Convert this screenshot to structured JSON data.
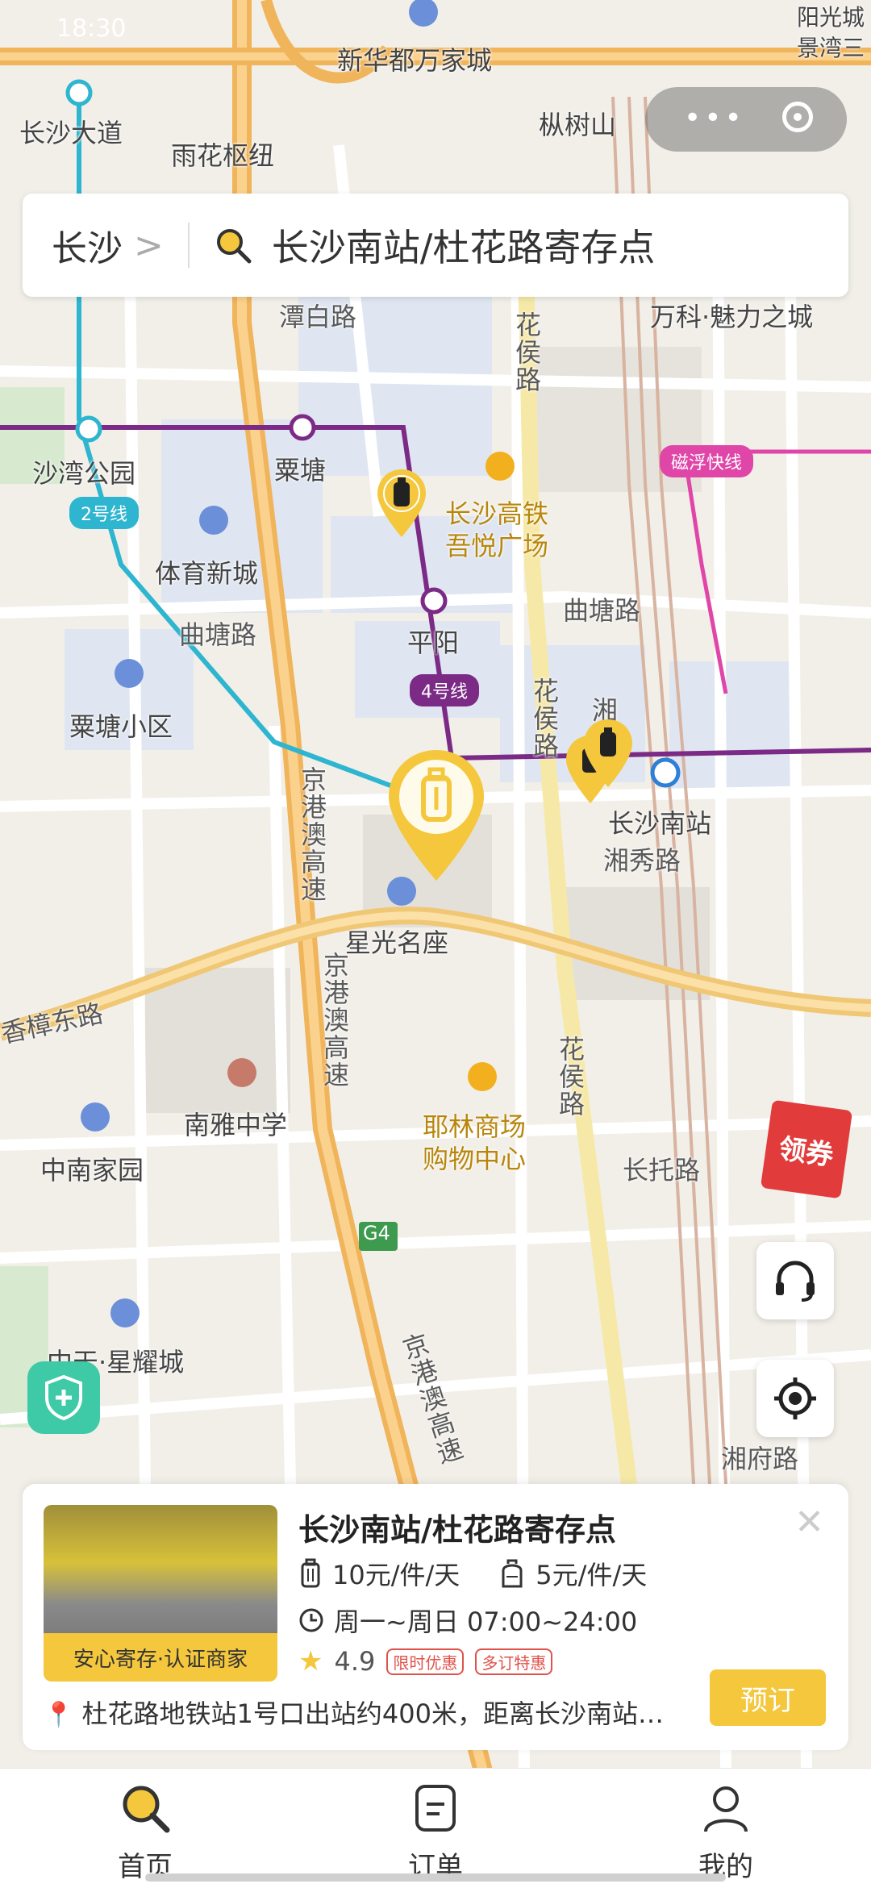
{
  "status_bar": {
    "time": "18:30"
  },
  "capsule": {
    "more_icon": "more-dots-icon",
    "close_icon": "target-icon"
  },
  "search": {
    "city": "长沙",
    "query": "长沙南站/杜花路寄存点"
  },
  "map_labels": {
    "xinhua": "新华都万家城",
    "yanguang": "阳光城",
    "jingwan": "景湾三",
    "changsha_dadao": "长沙大道",
    "yuhua_shuniu": "雨花枢纽",
    "fengshu": "枞树山",
    "tanbai": "潭白路",
    "wanke": "万科·魅力之城",
    "huahou1": "花侯路",
    "shawan_park": "沙湾公园",
    "line2": "2号线",
    "litang_station": "粟塘",
    "cs_gaotie_1": "长沙高铁",
    "cs_gaotie_2": "吾悦广场",
    "maglev": "磁浮快线",
    "tiyu": "体育新城",
    "qutang1": "曲塘路",
    "qutang2": "曲塘路",
    "pingyang": "平阳",
    "line4": "4号线",
    "litang_xiaoqu": "粟塘小区",
    "huahou2": "花侯路",
    "xiang": "湘",
    "cs_south": "长沙南站",
    "xiangxiu": "湘秀路",
    "jgao1": "京港澳高速",
    "xingguang": "星光名座",
    "xiangzhang": "香樟东路",
    "jgao2": "京港澳高速",
    "nanya": "南雅中学",
    "yelin1": "耶林商场",
    "yelin2": "购物中心",
    "huahou3": "花侯路",
    "zhongnan": "中南家园",
    "changtuo": "长托路",
    "g4": "G4",
    "jgao3": "京港澳高速",
    "zhongtian": "中天·星耀城",
    "xiangfu": "湘府路"
  },
  "redpacket": {
    "label": "领券"
  },
  "store_card": {
    "title": "长沙南站/杜花路寄存点",
    "badge": "安心寄存·认证商家",
    "price_large": "10元/件/天",
    "price_small": "5元/件/天",
    "hours": "周一~周日 07:00~24:00",
    "rating": "4.9",
    "tag1": "限时优惠",
    "tag2": "多订特惠",
    "address": "杜花路地铁站1号口出站约400米，距离长沙南站…",
    "book_label": "预订"
  },
  "tabs": [
    {
      "label": "首页",
      "icon": "search-icon"
    },
    {
      "label": "订单",
      "icon": "order-icon"
    },
    {
      "label": "我的",
      "icon": "user-icon"
    }
  ],
  "colors": {
    "accent": "#f4c73d",
    "line4": "#7b2a86",
    "line2": "#2eb5cf",
    "maglev": "#e045a8",
    "highway": "#f0b45a"
  }
}
